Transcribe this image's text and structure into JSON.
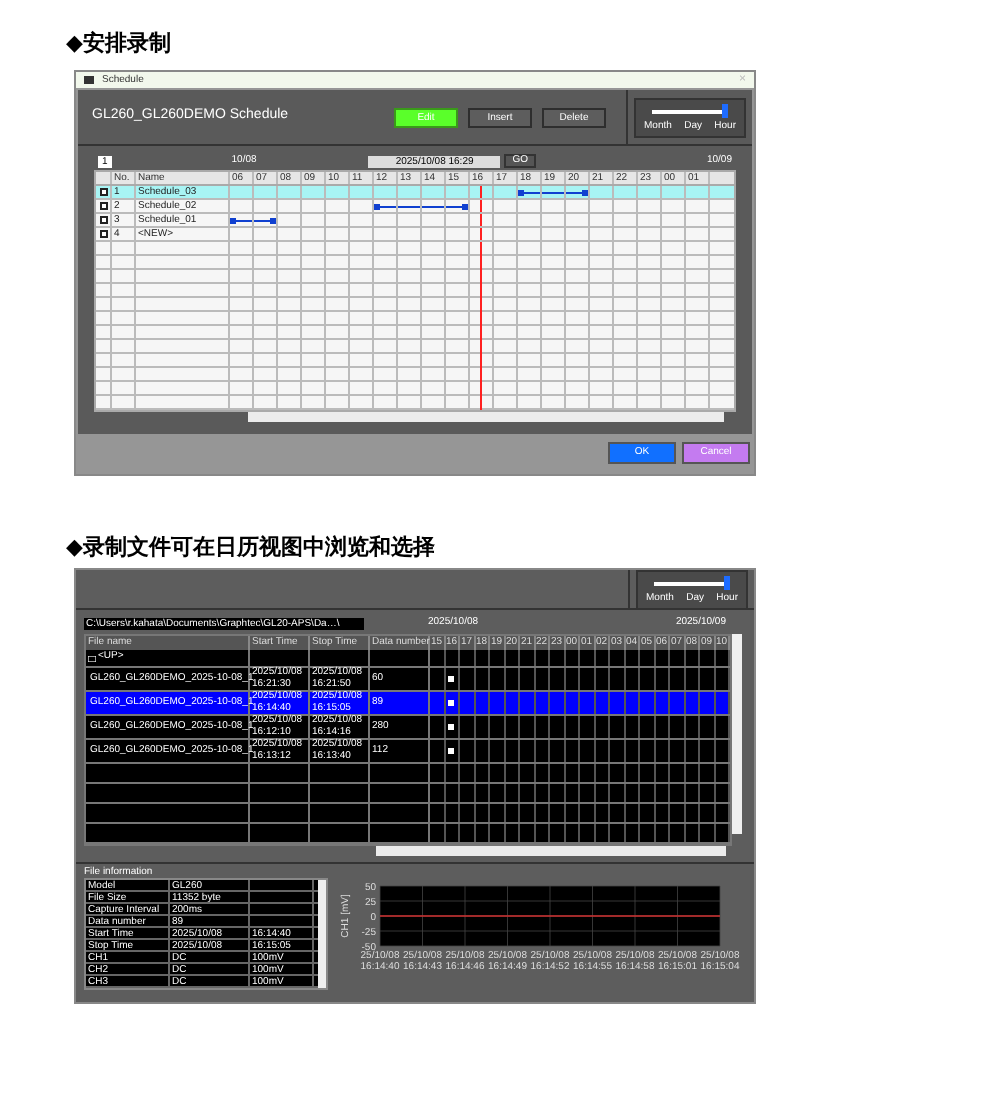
{
  "schedule_heading": "◆安排录制",
  "schedule_window": {
    "title": "Schedule",
    "close": "×",
    "schedule_title": "GL260_GL260DEMO Schedule",
    "buttons": [
      {
        "label": "Edit",
        "selected": true
      },
      {
        "label": "Insert",
        "selected": false
      },
      {
        "label": "Delete",
        "selected": false
      }
    ],
    "zoom": {
      "labels": [
        "Month",
        "Day",
        "Hour"
      ],
      "level": 1
    },
    "page": "1",
    "date_left": "10/08",
    "date_field": "2025/10/08 16:29",
    "go": "GO",
    "date_right": "10/09",
    "columns": [
      "No.",
      "Name"
    ],
    "hours": [
      "06",
      "07",
      "08",
      "09",
      "10",
      "11",
      "12",
      "13",
      "14",
      "15",
      "16",
      "17",
      "18",
      "19",
      "20",
      "21",
      "22",
      "23",
      "00",
      "01"
    ],
    "rows": [
      {
        "no": "1",
        "name": "Schedule_03",
        "selected": true,
        "scheduled": [
          false,
          false,
          false,
          false,
          false,
          false,
          false,
          false,
          false,
          false,
          false,
          false,
          true,
          true,
          true,
          false,
          false,
          false,
          false,
          false
        ]
      },
      {
        "no": "2",
        "name": "Schedule_02",
        "selected": false,
        "scheduled": [
          false,
          false,
          false,
          false,
          false,
          false,
          true,
          true,
          true,
          true,
          false,
          false,
          false,
          false,
          false,
          false,
          false,
          false,
          false,
          false
        ]
      },
      {
        "no": "3",
        "name": "Schedule_01",
        "selected": false,
        "scheduled": [
          true,
          true,
          false,
          false,
          false,
          false,
          false,
          false,
          false,
          false,
          false,
          false,
          false,
          false,
          false,
          false,
          false,
          false,
          false,
          false
        ]
      },
      {
        "no": "4",
        "name": "<NEW>",
        "selected": false,
        "scheduled": [
          false,
          false,
          false,
          false,
          false,
          false,
          false,
          false,
          false,
          false,
          false,
          false,
          false,
          false,
          false,
          false,
          false,
          false,
          false,
          false
        ]
      }
    ],
    "footer_buttons": [
      {
        "label": "OK",
        "kind": "ok"
      },
      {
        "label": "Cancel",
        "kind": "cancel"
      }
    ]
  },
  "browse_heading": "◆录制文件可在日历视图中浏览和选择",
  "browse_window": {
    "zoom": {
      "labels": [
        "Month",
        "Day",
        "Hour"
      ],
      "level": 1
    },
    "path": "C:\\Users\\r.kahata\\Documents\\Graphtec\\GL20-APS\\Da…\\",
    "date_left": "2025/10/08",
    "date_right": "2025/10/09",
    "columns": [
      "File name",
      "Start Time",
      "Stop Time",
      "Data number"
    ],
    "hours": [
      "15",
      "16",
      "17",
      "18",
      "19",
      "20",
      "21",
      "22",
      "23",
      "00",
      "01",
      "02",
      "03",
      "04",
      "05",
      "06",
      "07",
      "08",
      "09",
      "10"
    ],
    "rows": [
      {
        "kind": "up",
        "name": "<UP>",
        "selected": false
      },
      {
        "kind": "file",
        "name": "GL260_GL260DEMO_2025-10-08_1",
        "start": [
          "2025/10/08",
          "16:21:30"
        ],
        "stop": [
          "2025/10/08",
          "16:21:50"
        ],
        "count": "60",
        "selected": false,
        "marked": [
          false,
          true,
          false,
          false,
          false,
          false,
          false,
          false,
          false,
          false,
          false,
          false,
          false,
          false,
          false,
          false,
          false,
          false,
          false,
          false
        ]
      },
      {
        "kind": "file",
        "name": "GL260_GL260DEMO_2025-10-08_1",
        "start": [
          "2025/10/08",
          "16:14:40"
        ],
        "stop": [
          "2025/10/08",
          "16:15:05"
        ],
        "count": "89",
        "selected": true,
        "marked": [
          false,
          true,
          false,
          false,
          false,
          false,
          false,
          false,
          false,
          false,
          false,
          false,
          false,
          false,
          false,
          false,
          false,
          false,
          false,
          false
        ]
      },
      {
        "kind": "file",
        "name": "GL260_GL260DEMO_2025-10-08_1",
        "start": [
          "2025/10/08",
          "16:12:10"
        ],
        "stop": [
          "2025/10/08",
          "16:14:16"
        ],
        "count": "280",
        "selected": false,
        "marked": [
          false,
          true,
          false,
          false,
          false,
          false,
          false,
          false,
          false,
          false,
          false,
          false,
          false,
          false,
          false,
          false,
          false,
          false,
          false,
          false
        ]
      },
      {
        "kind": "file",
        "name": "GL260_GL260DEMO_2025-10-08_1",
        "start": [
          "2025/10/08",
          "16:13:12"
        ],
        "stop": [
          "2025/10/08",
          "16:13:40"
        ],
        "count": "112",
        "selected": false,
        "marked": [
          false,
          true,
          false,
          false,
          false,
          false,
          false,
          false,
          false,
          false,
          false,
          false,
          false,
          false,
          false,
          false,
          false,
          false,
          false,
          false
        ]
      }
    ],
    "info_title": "File information",
    "info_rows": [
      [
        "Model",
        "GL260",
        ""
      ],
      [
        "File Size",
        "11352 byte",
        ""
      ],
      [
        "Capture Interval",
        "200ms",
        ""
      ],
      [
        "Data number",
        "89",
        ""
      ],
      [
        "Start Time",
        "2025/10/08",
        "16:14:40"
      ],
      [
        "Stop Time",
        "2025/10/08",
        "16:15:05"
      ],
      [
        "CH1",
        "DC",
        "100mV"
      ],
      [
        "CH2",
        "DC",
        "100mV"
      ],
      [
        "CH3",
        "DC",
        "100mV"
      ]
    ],
    "chart_data": {
      "type": "line",
      "grid": true,
      "ylabel": "CH1 [mV]",
      "x": [
        "25/10/08 16:14:40",
        "25/10/08 16:14:43",
        "25/10/08 16:14:46",
        "25/10/08 16:14:49",
        "25/10/08 16:14:52",
        "25/10/08 16:14:55",
        "25/10/08 16:14:58",
        "25/10/08 16:15:01",
        "25/10/08 16:15:04"
      ],
      "ylim": [
        -50,
        50
      ],
      "yticks": [
        50,
        25,
        0,
        -25,
        -50
      ],
      "series": [
        {
          "color": "#d03030",
          "values": [
            0,
            0,
            0,
            0,
            0,
            0,
            0,
            0,
            0
          ]
        }
      ]
    }
  }
}
